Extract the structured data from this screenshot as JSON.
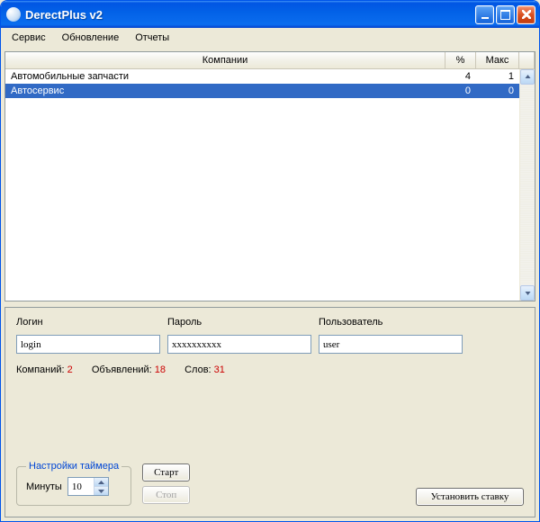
{
  "window": {
    "title": "DerectPlus v2"
  },
  "menu": {
    "service": "Сервис",
    "update": "Обновление",
    "reports": "Отчеты"
  },
  "table": {
    "headers": {
      "company": "Компании",
      "pct": "%",
      "max": "Макс"
    },
    "rows": [
      {
        "company": "Автомобильные запчасти",
        "pct": "4",
        "max": "1",
        "selected": false
      },
      {
        "company": "Автосервис",
        "pct": "0",
        "max": "0",
        "selected": true
      }
    ]
  },
  "form": {
    "login_label": "Логин",
    "password_label": "Пароль",
    "user_label": "Пользователь",
    "login_value": "login",
    "password_value": "xxxxxxxxxx",
    "user_value": "user"
  },
  "stats": {
    "companies_label": "Компаний:",
    "companies_value": "2",
    "ads_label": "Объявлений:",
    "ads_value": "18",
    "words_label": "Слов:",
    "words_value": "31"
  },
  "timer": {
    "legend": "Настройки таймера",
    "minutes_label": "Минуты",
    "minutes_value": "10"
  },
  "buttons": {
    "start": "Старт",
    "stop": "Стоп",
    "set_bid": "Установить ставку"
  }
}
